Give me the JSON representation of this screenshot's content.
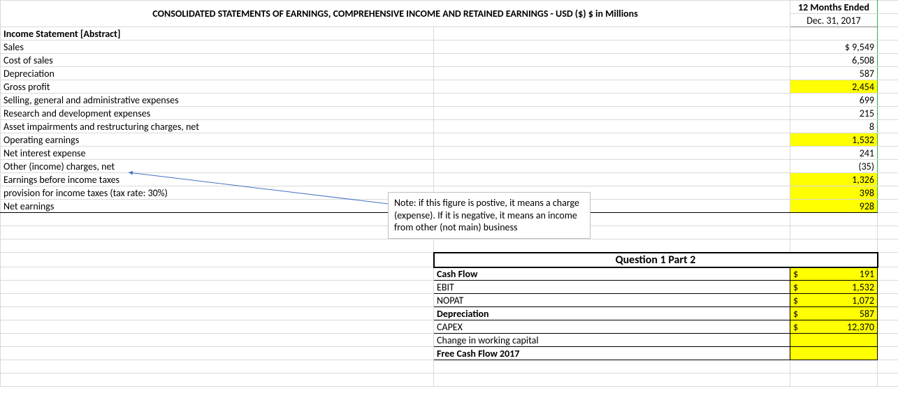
{
  "header": {
    "title": "CONSOLIDATED STATEMENTS OF EARNINGS, COMPREHENSIVE INCOME AND RETAINED EARNINGS - USD ($) $ in Millions",
    "period_label": "12 Months Ended",
    "period_date": "Dec. 31, 2017"
  },
  "income_statement": {
    "section_title": "Income Statement [Abstract]",
    "rows": [
      {
        "label": "Sales",
        "value": "$ 9,549",
        "highlight": false
      },
      {
        "label": "Cost of sales",
        "value": "6,508",
        "highlight": false
      },
      {
        "label": "Depreciation",
        "value": "587",
        "highlight": false
      },
      {
        "label": "Gross profit",
        "value": "2,454",
        "highlight": true
      },
      {
        "label": "Selling, general and administrative expenses",
        "value": "699",
        "highlight": false
      },
      {
        "label": "Research and development expenses",
        "value": "215",
        "highlight": false
      },
      {
        "label": "Asset impairments and restructuring charges, net",
        "value": "8",
        "highlight": false
      },
      {
        "label": "Operating earnings",
        "value": "1,532",
        "highlight": true
      },
      {
        "label": "Net interest expense",
        "value": "241",
        "highlight": false
      },
      {
        "label": "Other (income) charges, net",
        "value": "(35)",
        "highlight": false
      },
      {
        "label": "Earnings before income taxes",
        "value": "1,326",
        "highlight": true
      },
      {
        "label": "provision for income taxes (tax rate: 30%)",
        "value": "398",
        "highlight": true
      },
      {
        "label": "Net earnings",
        "value": "928",
        "highlight": true
      }
    ]
  },
  "note": {
    "text": "Note: if this figure is postive, it means a charge (expense). If it is negative, it means an income from other (not main) business"
  },
  "question": {
    "title": "Question 1 Part 2",
    "currency": "$",
    "rows": [
      {
        "label": "Cash Flow",
        "value": "191",
        "bold": true,
        "has_value": true
      },
      {
        "label": "EBIT",
        "value": "1,532",
        "bold": false,
        "has_value": true
      },
      {
        "label": "NOPAT",
        "value": "1,072",
        "bold": false,
        "has_value": true
      },
      {
        "label": "Depreciation",
        "value": "587",
        "bold": true,
        "has_value": true
      },
      {
        "label": "CAPEX",
        "value": "12,370",
        "bold": false,
        "has_value": true
      },
      {
        "label": "Change in working capital",
        "value": "",
        "bold": false,
        "has_value": false
      },
      {
        "label": "Free Cash Flow 2017",
        "value": "",
        "bold": true,
        "has_value": false
      }
    ]
  }
}
